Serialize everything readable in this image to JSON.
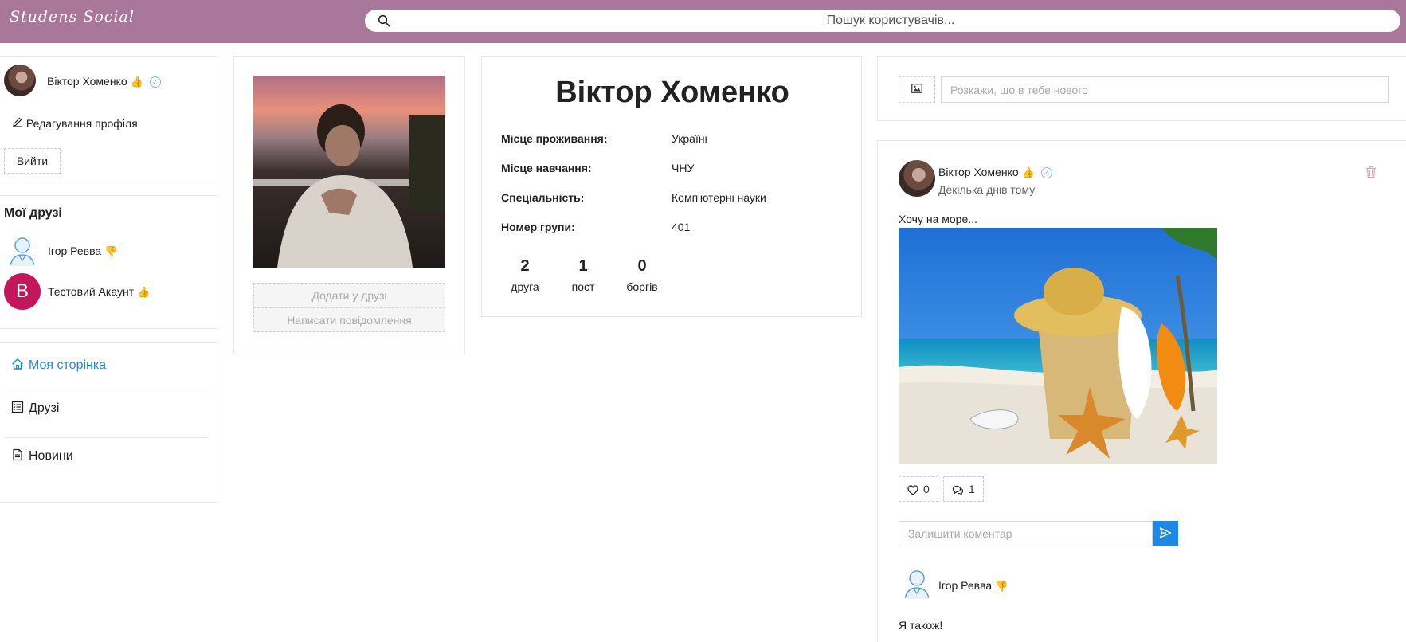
{
  "header": {
    "logo": "Studens Social",
    "search_placeholder": "Пошук користувачів..."
  },
  "user_card": {
    "name": "Віктор Хоменко",
    "edit_label": "Редагування профіля",
    "logout_label": "Вийти"
  },
  "friends": {
    "title": "Мої друзі",
    "items": [
      {
        "name": "Ігор Ревва",
        "reaction": "thumbs-down",
        "avatar": "person-outline"
      },
      {
        "name": "Тестовий Акаунт",
        "reaction": "thumbs-up",
        "avatar_letter": "В"
      }
    ]
  },
  "nav": {
    "items": [
      {
        "label": "Моя сторінка",
        "icon": "home-icon",
        "active": true
      },
      {
        "label": "Друзі",
        "icon": "list-icon",
        "active": false
      },
      {
        "label": "Новини",
        "icon": "document-icon",
        "active": false
      }
    ]
  },
  "profile_actions": {
    "add_friend": "Додати у друзі",
    "write_message": "Написати повідомлення"
  },
  "profile": {
    "name": "Віктор Хоменко",
    "fields": [
      {
        "label": "Місце проживання:",
        "value": "Україні"
      },
      {
        "label": "Місце навчання:",
        "value": "ЧНУ"
      },
      {
        "label": "Спеціальність:",
        "value": "Комп'ютерні науки"
      },
      {
        "label": "Номер групи:",
        "value": "401"
      }
    ],
    "stats": [
      {
        "value": "2",
        "label": "друга"
      },
      {
        "value": "1",
        "label": "пост"
      },
      {
        "value": "0",
        "label": "боргів"
      }
    ]
  },
  "compose": {
    "placeholder": "Розкажи, що в тебе нового"
  },
  "post": {
    "author": "Віктор Хоменко",
    "time": "Декілька днів тому",
    "text": "Хочу на море...",
    "likes": "0",
    "comments": "1",
    "comment_placeholder": "Залишити коментар",
    "comment": {
      "author": "Ігор Ревва",
      "text": "Я також!"
    }
  },
  "colors": {
    "header": "#a8779a",
    "accent": "#1e88e5",
    "thumb_up": "#8ee0c2",
    "thumb_down": "#f09aa8",
    "letter_avatar": "#c2185b"
  }
}
